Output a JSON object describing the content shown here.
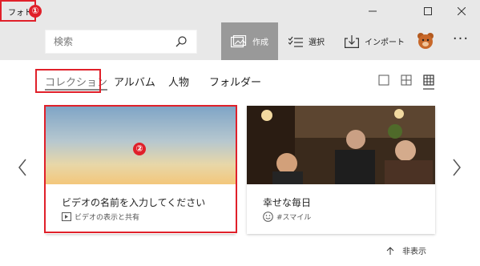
{
  "app": {
    "title": "フォト"
  },
  "annotations": {
    "one": "①",
    "two": "②"
  },
  "window": {
    "minimize": "minimize",
    "maximize": "maximize",
    "close": "close"
  },
  "search": {
    "placeholder": "検索"
  },
  "toolbar": {
    "create_label": "作成",
    "select_label": "選択",
    "import_label": "インポート",
    "more_label": "···"
  },
  "tabs": [
    {
      "label": "コレクション",
      "active": true
    },
    {
      "label": "アルバム",
      "active": false
    },
    {
      "label": "人物",
      "active": false
    },
    {
      "label": "フォルダー",
      "active": false
    }
  ],
  "view_modes": [
    "small",
    "medium",
    "large"
  ],
  "cards": [
    {
      "title": "ビデオの名前を入力してください",
      "subtitle": "ビデオの表示と共有",
      "icon": "video-icon"
    },
    {
      "title": "幸せな毎日",
      "subtitle": "#スマイル",
      "icon": "smiley-icon"
    }
  ],
  "footer": {
    "hide_label": "非表示"
  },
  "colors": {
    "annotation": "#e0202a",
    "active_tool": "#999999",
    "chrome": "#e8e8e8"
  }
}
